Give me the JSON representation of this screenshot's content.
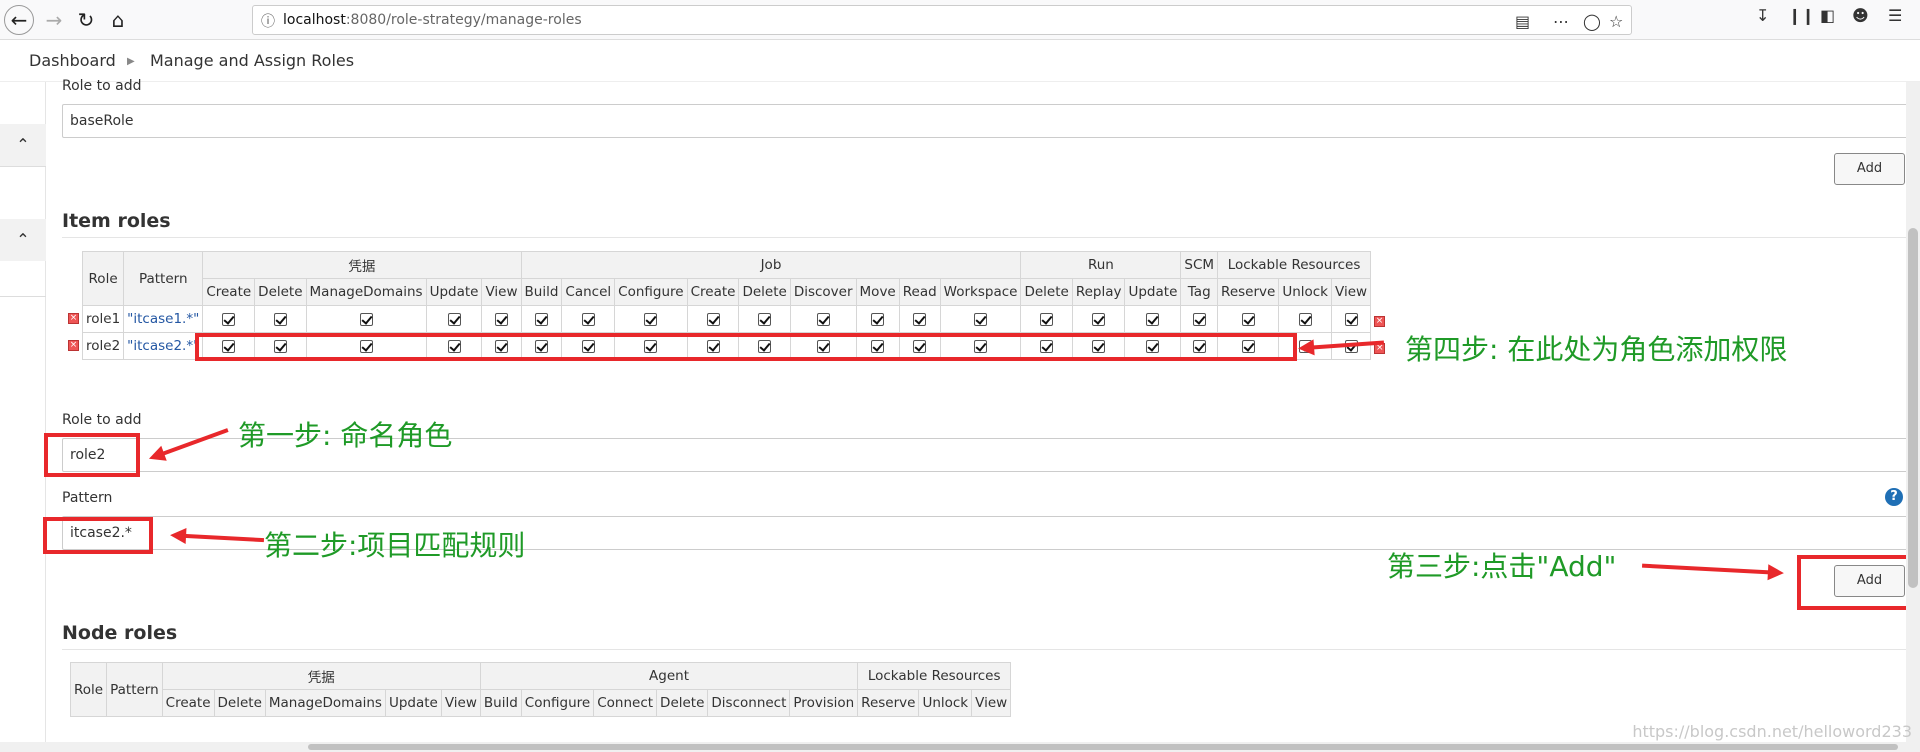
{
  "browser": {
    "url_host": "localhost",
    "url_rest": ":8080/role-strategy/manage-roles"
  },
  "breadcrumb": {
    "items": [
      "Dashboard",
      "Manage and Assign Roles"
    ]
  },
  "global_roles": {
    "role_to_add_label": "Role to add",
    "role_to_add_value": "baseRole",
    "add_label": "Add"
  },
  "item_roles": {
    "heading": "Item roles",
    "header_groups": [
      "凭据",
      "Job",
      "Run",
      "SCM",
      "Lockable Resources"
    ],
    "col_role": "Role",
    "col_pattern": "Pattern",
    "permissions": [
      "Create",
      "Delete",
      "ManageDomains",
      "Update",
      "View",
      "Build",
      "Cancel",
      "Configure",
      "Create",
      "Delete",
      "Discover",
      "Move",
      "Read",
      "Workspace",
      "Delete",
      "Replay",
      "Update",
      "Tag",
      "Reserve",
      "Unlock",
      "View"
    ],
    "rows": [
      {
        "role": "role1",
        "pattern": "\"itcase1.*\""
      },
      {
        "role": "role2",
        "pattern": "\"itcase2.*\""
      }
    ],
    "role_to_add_label": "Role to add",
    "role_to_add_value": "role2",
    "pattern_label": "Pattern",
    "pattern_value": "itcase2.*",
    "add_label": "Add"
  },
  "node_roles": {
    "heading": "Node roles",
    "header_groups": [
      "凭据",
      "Agent",
      "Lockable Resources"
    ],
    "col_role": "Role",
    "col_pattern": "Pattern",
    "permissions": [
      "Create",
      "Delete",
      "ManageDomains",
      "Update",
      "View",
      "Build",
      "Configure",
      "Connect",
      "Delete",
      "Disconnect",
      "Provision",
      "Reserve",
      "Unlock",
      "View"
    ]
  },
  "annotations": {
    "step1": "第一步: 命名角色",
    "step2": "第二步:项目匹配规则",
    "step3": "第三步:点击\"Add\"",
    "step4": "第四步: 在此处为角色添加权限"
  },
  "watermark": "https://blog.csdn.net/helloword233",
  "colors": {
    "annotation_green": "#1f9a27",
    "annotation_red": "#e8282b",
    "pattern_blue": "#2457a3"
  }
}
